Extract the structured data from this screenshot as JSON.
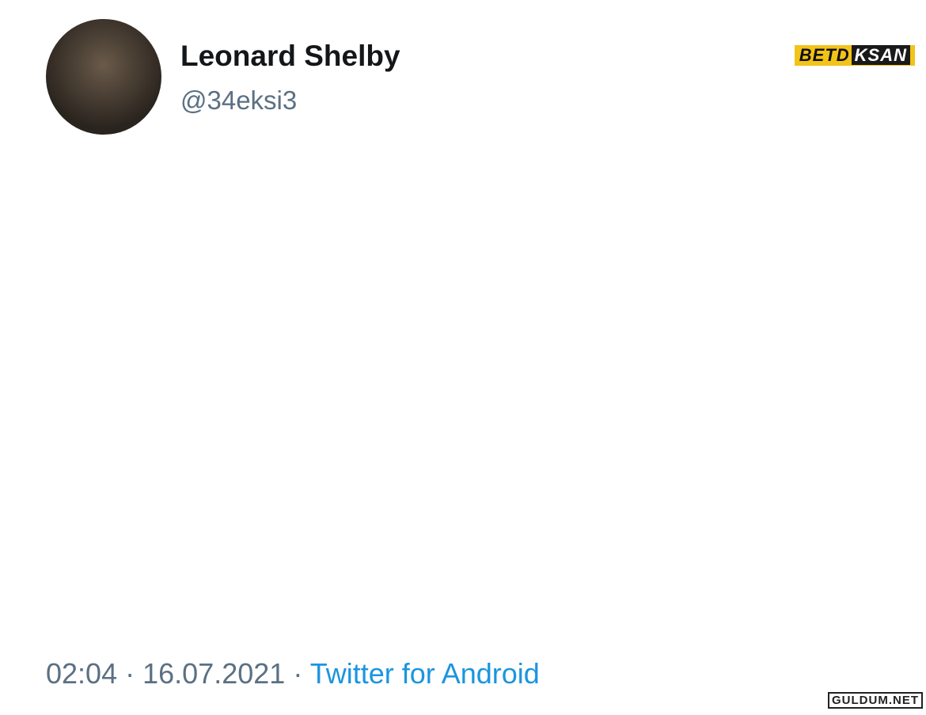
{
  "author": {
    "name": "Leonard Shelby",
    "handle": "@34eksi3"
  },
  "brand": {
    "logo_left": "BETD",
    "logo_right": "KSAN",
    "color": "#f2c318"
  },
  "tweet": {
    "lines": [
      "",
      "",
      "",
      "",
      "",
      ""
    ]
  },
  "meta": {
    "time": "02:04",
    "separator": "·",
    "date": "16.07.2021",
    "source": "Twitter for Android"
  },
  "watermark": "GULDUM.NET"
}
